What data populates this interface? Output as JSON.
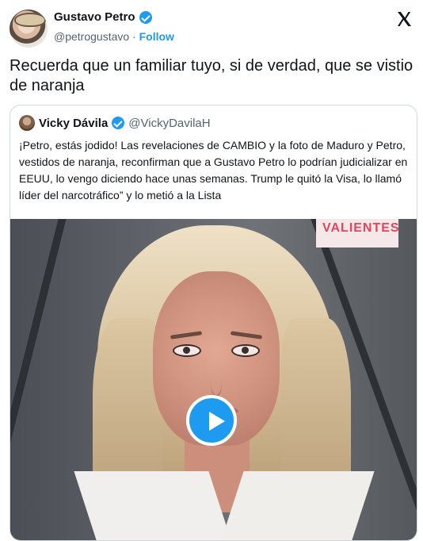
{
  "author": {
    "name": "Gustavo Petro",
    "handle": "@petrogustavo",
    "follow_label": "Follow"
  },
  "tweet_text": "Recuerda que un familiar tuyo, si de verdad, que se vistio de naranja",
  "quoted_tweet": {
    "name": "Vicky Dávila",
    "handle": "@VickyDavilaH",
    "text": "¡Petro, estás jodido! Las revelaciones de CAMBIO y la foto de Maduro y Petro, vestidos de naranja, reconfirman que a Gustavo Petro lo podrían judicializar en EEUU, lo vengo diciendo hace unas semanas. Trump le quitó la Visa, lo llamó líder del narcotráfico” y lo metió a la Lista"
  },
  "video": {
    "overlay_text": "VALIENTES"
  },
  "icons": {
    "verified": "verified-badge-icon",
    "x_logo": "x-logo-icon",
    "play": "play-icon"
  },
  "colors": {
    "accent": "#1d9bf0",
    "text": "#0f1419",
    "muted": "#536471",
    "border": "#cfd9de"
  }
}
